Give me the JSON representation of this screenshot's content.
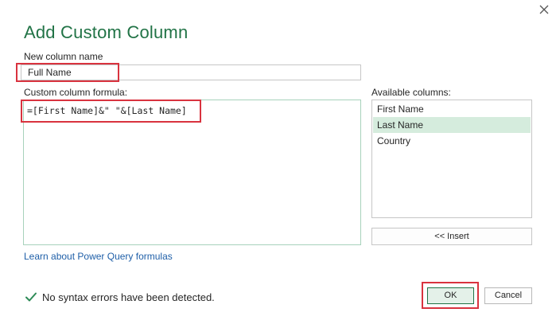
{
  "dialog": {
    "title": "Add Custom Column",
    "close_icon": "close-icon"
  },
  "name_field": {
    "label": "New column name",
    "value": "Full Name"
  },
  "formula_field": {
    "label": "Custom column formula:",
    "value": "=[First Name]&\" \"&[Last Name]"
  },
  "available_columns": {
    "label": "Available columns:",
    "items": [
      {
        "label": "First Name",
        "selected": false
      },
      {
        "label": "Last Name",
        "selected": true
      },
      {
        "label": "Country",
        "selected": false
      }
    ],
    "insert_label": "<< Insert"
  },
  "learn_link": "Learn about Power Query formulas",
  "status": {
    "icon": "check-icon",
    "text": "No syntax errors have been detected."
  },
  "buttons": {
    "ok": "OK",
    "cancel": "Cancel"
  },
  "colors": {
    "accent": "#217346",
    "highlight": "#d9333f",
    "selected_row": "#d5ecdd",
    "link": "#1f5fa8"
  }
}
